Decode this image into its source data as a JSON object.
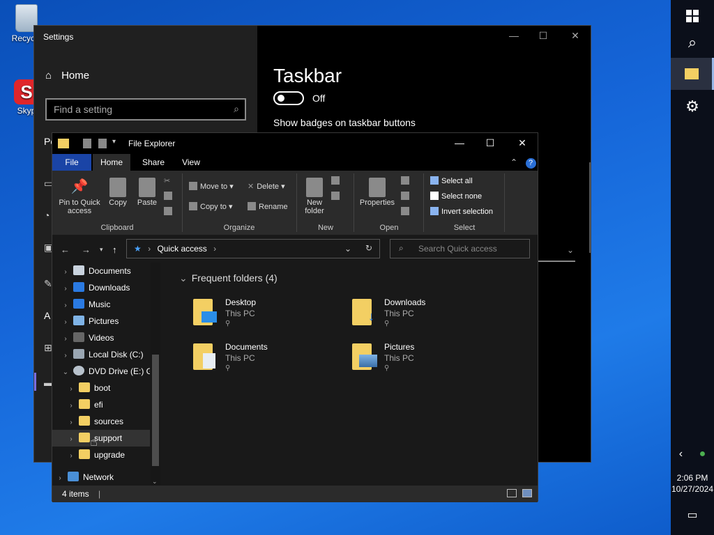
{
  "desktop": {
    "icons": [
      {
        "label": "Recycle",
        "icon": "recycle-bin-icon"
      },
      {
        "label": "Skyp",
        "icon": "skype-icon"
      }
    ]
  },
  "settings": {
    "window_title": "Settings",
    "home_label": "Home",
    "search_placeholder": "Find a setting",
    "page_title": "Taskbar",
    "toggle_state": "Off",
    "option_label": "Show badges on taskbar buttons",
    "partial_label": "Pe",
    "partial_label_2": "A"
  },
  "explorer": {
    "title": "File Explorer",
    "tabs": {
      "file": "File",
      "home": "Home",
      "share": "Share",
      "view": "View"
    },
    "ribbon": {
      "pin": "Pin to Quick access",
      "copy": "Copy",
      "paste": "Paste",
      "move_to": "Move to",
      "copy_to": "Copy to",
      "delete": "Delete",
      "rename": "Rename",
      "new_folder": "New folder",
      "properties": "Properties",
      "select_all": "Select all",
      "select_none": "Select none",
      "invert_selection": "Invert selection",
      "groups": {
        "clipboard": "Clipboard",
        "organize": "Organize",
        "new": "New",
        "open": "Open",
        "select": "Select"
      }
    },
    "address": {
      "path": "Quick access",
      "search_placeholder": "Search Quick access"
    },
    "nav": {
      "items": [
        {
          "label": "Documents",
          "icon": "documents-icon"
        },
        {
          "label": "Downloads",
          "icon": "downloads-icon"
        },
        {
          "label": "Music",
          "icon": "music-icon"
        },
        {
          "label": "Pictures",
          "icon": "pictures-icon"
        },
        {
          "label": "Videos",
          "icon": "videos-icon"
        },
        {
          "label": "Local Disk (C:)",
          "icon": "drive-icon"
        },
        {
          "label": "DVD Drive (E:) G:",
          "icon": "dvd-icon"
        },
        {
          "label": "boot",
          "icon": "folder-icon"
        },
        {
          "label": "efi",
          "icon": "folder-icon"
        },
        {
          "label": "sources",
          "icon": "folder-icon"
        },
        {
          "label": "support",
          "icon": "folder-icon"
        },
        {
          "label": "upgrade",
          "icon": "folder-icon"
        },
        {
          "label": "Network",
          "icon": "network-icon"
        }
      ]
    },
    "content": {
      "section_title": "Frequent folders (4)",
      "folders": [
        {
          "name": "Desktop",
          "location": "This PC",
          "icon": "desktop-folder-icon"
        },
        {
          "name": "Downloads",
          "location": "This PC",
          "icon": "downloads-folder-icon"
        },
        {
          "name": "Documents",
          "location": "This PC",
          "icon": "documents-folder-icon"
        },
        {
          "name": "Pictures",
          "location": "This PC",
          "icon": "pictures-folder-icon"
        }
      ]
    },
    "status": {
      "items": "4 items"
    }
  },
  "taskbar": {
    "time": "2:06 PM",
    "date": "10/27/2024"
  },
  "colors": {
    "accent": "#1a44a6",
    "desktop": "#1565d8",
    "folder": "#f3cf63"
  }
}
